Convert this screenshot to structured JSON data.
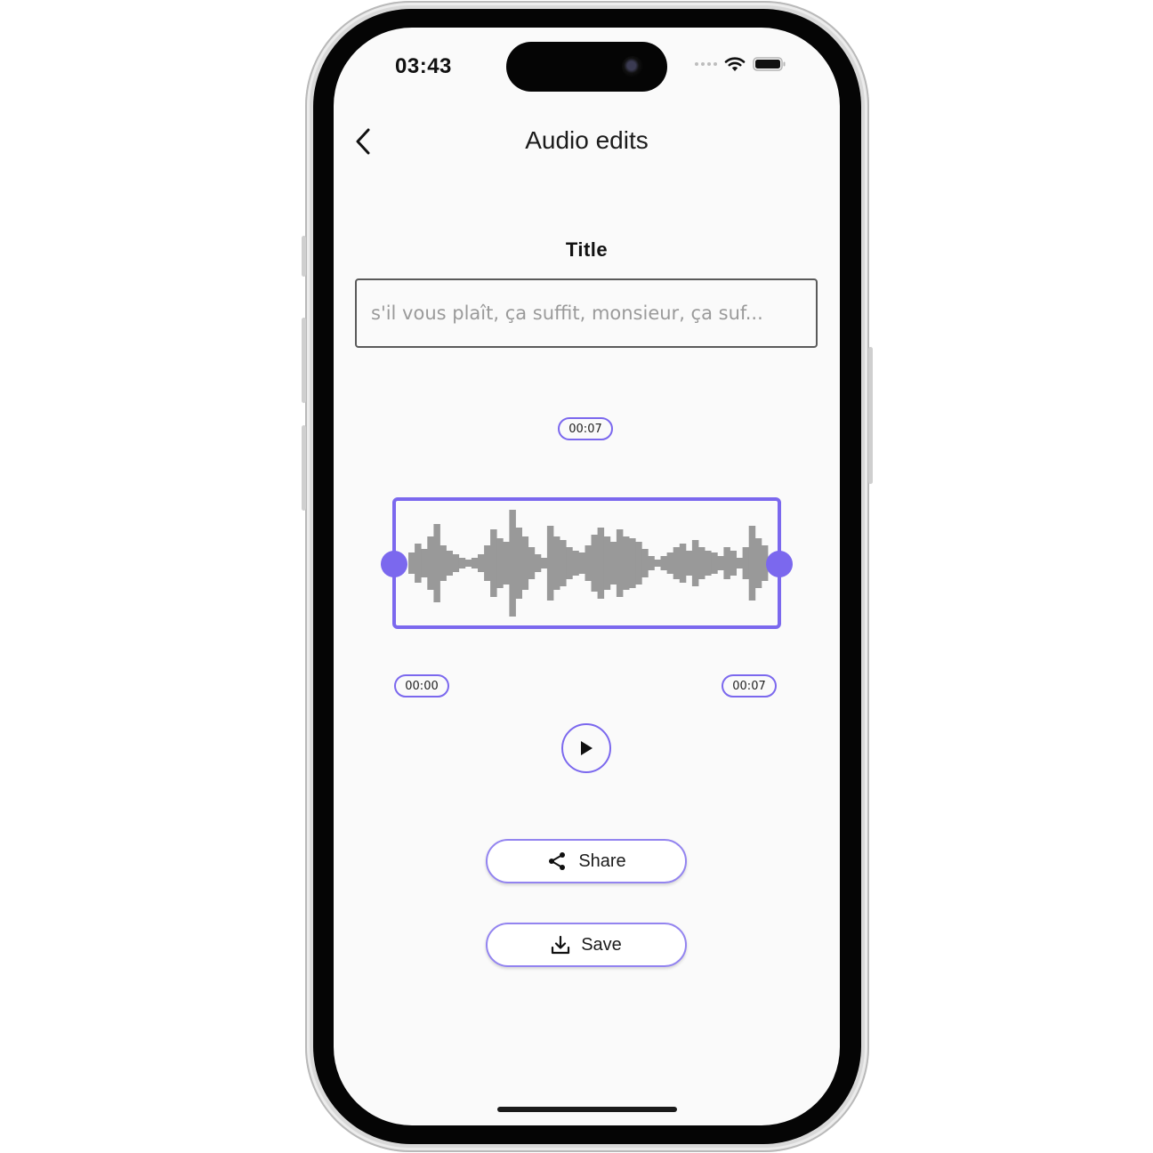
{
  "status_bar": {
    "time": "03:43"
  },
  "header": {
    "back_icon": "chevron-left-icon",
    "title": "Audio edits"
  },
  "form": {
    "title_label": "Title",
    "title_placeholder": "s'il vous plaît, ça suffit, monsieur, ça suf...",
    "title_value": ""
  },
  "editor": {
    "duration": "00:07",
    "trim_start": "00:00",
    "trim_end": "00:07",
    "waveform_heights": [
      12,
      22,
      16,
      30,
      44,
      20,
      14,
      10,
      6,
      4,
      6,
      10,
      20,
      38,
      28,
      24,
      60,
      40,
      30,
      18,
      10,
      6,
      42,
      30,
      26,
      18,
      14,
      12,
      20,
      32,
      40,
      30,
      24,
      38,
      30,
      28,
      24,
      16,
      8,
      4,
      8,
      12,
      18,
      22,
      14,
      26,
      18,
      14,
      12,
      8,
      18,
      14,
      6,
      18,
      42,
      28,
      20
    ]
  },
  "play_icon": "play-icon",
  "actions": {
    "share_label": "Share",
    "share_icon": "share-icon",
    "save_label": "Save",
    "save_icon": "download-icon"
  },
  "colors": {
    "accent": "#7b68ee",
    "waveform": "#999999"
  }
}
